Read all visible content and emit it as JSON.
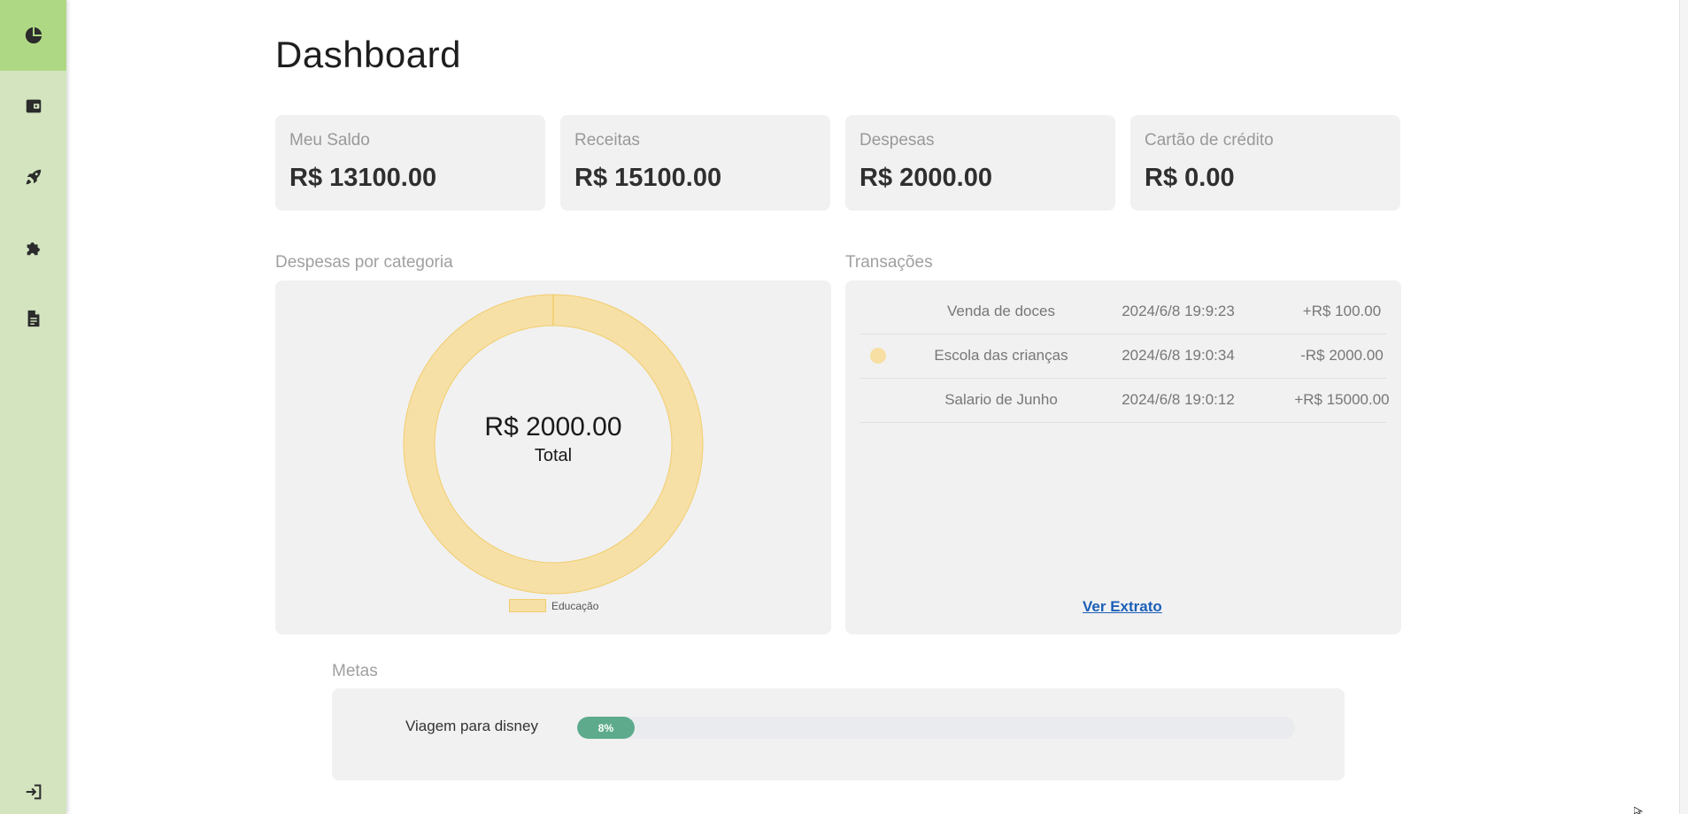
{
  "sidebar": {
    "items": [
      {
        "icon": "pie-chart-icon",
        "active": true
      },
      {
        "icon": "wallet-icon",
        "active": false
      },
      {
        "icon": "rocket-icon",
        "active": false
      },
      {
        "icon": "puzzle-icon",
        "active": false
      },
      {
        "icon": "document-icon",
        "active": false
      }
    ],
    "logout_icon": "logout-icon"
  },
  "header": {
    "title": "Dashboard"
  },
  "summary_cards": [
    {
      "label": "Meu Saldo",
      "value": "R$ 13100.00"
    },
    {
      "label": "Receitas",
      "value": "R$ 15100.00"
    },
    {
      "label": "Despesas",
      "value": "R$ 2000.00"
    },
    {
      "label": "Cartão de crédito",
      "value": "R$ 0.00"
    }
  ],
  "expenses_by_category": {
    "title": "Despesas por categoria",
    "center_value": "R$ 2000.00",
    "center_label": "Total",
    "legend": [
      "Educação"
    ]
  },
  "chart_data": {
    "type": "pie",
    "categories": [
      "Educação"
    ],
    "values": [
      2000
    ],
    "colors": [
      "#f7e0a6"
    ]
  },
  "transactions": {
    "title": "Transações",
    "rows": [
      {
        "description": "Venda de doces",
        "date": "2024/6/8 19:9:23",
        "amount": "+R$ 100.00",
        "has_dot": false
      },
      {
        "description": "Escola das crianças",
        "date": "2024/6/8 19:0:34",
        "amount": "-R$ 2000.00",
        "has_dot": true
      },
      {
        "description": "Salario de Junho",
        "date": "2024/6/8 19:0:12",
        "amount": "+R$ 15000.00",
        "has_dot": false
      }
    ],
    "link_label": "Ver Extrato"
  },
  "goals": {
    "title": "Metas",
    "items": [
      {
        "name": "Viagem para disney",
        "progress": 0.08,
        "progress_label": "8%"
      }
    ]
  },
  "colors": {
    "sidebar": "#d3e4bf",
    "sidebar_active": "#afd884",
    "donut": "#f7e0a6",
    "progress": "#5dab8c",
    "link": "#1c5fb8"
  }
}
